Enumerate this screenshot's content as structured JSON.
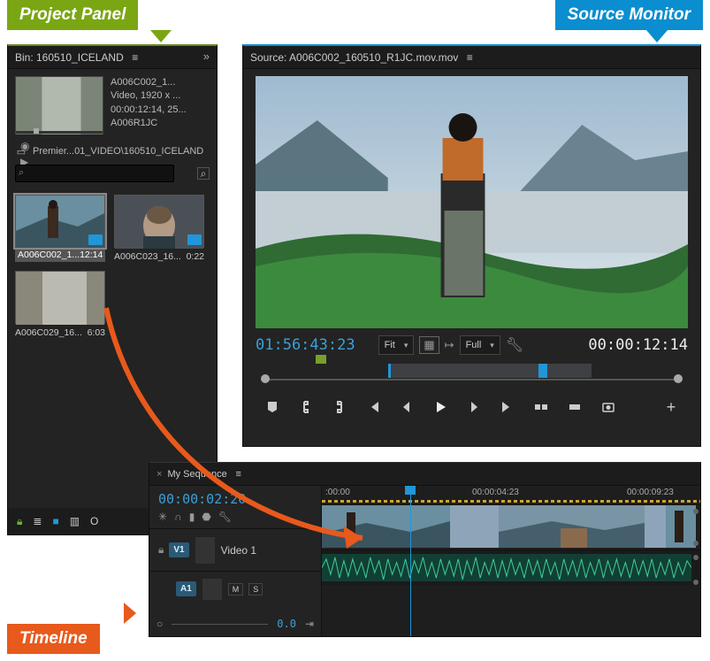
{
  "labels": {
    "project": "Project Panel",
    "source": "Source Monitor",
    "timeline": "Timeline"
  },
  "project": {
    "bin_label": "Bin: 160510_ICELAND",
    "path_label": "Premier...01_VIDEO\\160510_ICELAND",
    "chevrons": "»",
    "clip_name": "A006C002_1...",
    "clip_meta_line1": "Video, 1920 x ...",
    "clip_meta_line2": "00:00:12:14, 25...",
    "clip_meta_line3": "A006R1JC",
    "search_placeholder": "",
    "items": [
      {
        "name": "A006C002_1...",
        "dur": "12:14"
      },
      {
        "name": "A006C023_16...",
        "dur": "0:22"
      },
      {
        "name": "A006C029_16...",
        "dur": "6:03"
      }
    ]
  },
  "source": {
    "title": "Source: A006C002_160510_R1JC.mov.mov",
    "tc_left": "01:56:43:23",
    "fit_label": "Fit",
    "full_label": "Full",
    "tc_right": "00:00:12:14"
  },
  "timeline": {
    "seq_name": "My Sequence",
    "tc": "00:00:02:20",
    "track_v1": "V1",
    "track_v1_name": "Video 1",
    "track_a1": "A1",
    "ruler": {
      "t0": ":00:00",
      "t1": "00:00:04:23",
      "t2": "00:00:09:23"
    },
    "bs_num": "0.0"
  }
}
